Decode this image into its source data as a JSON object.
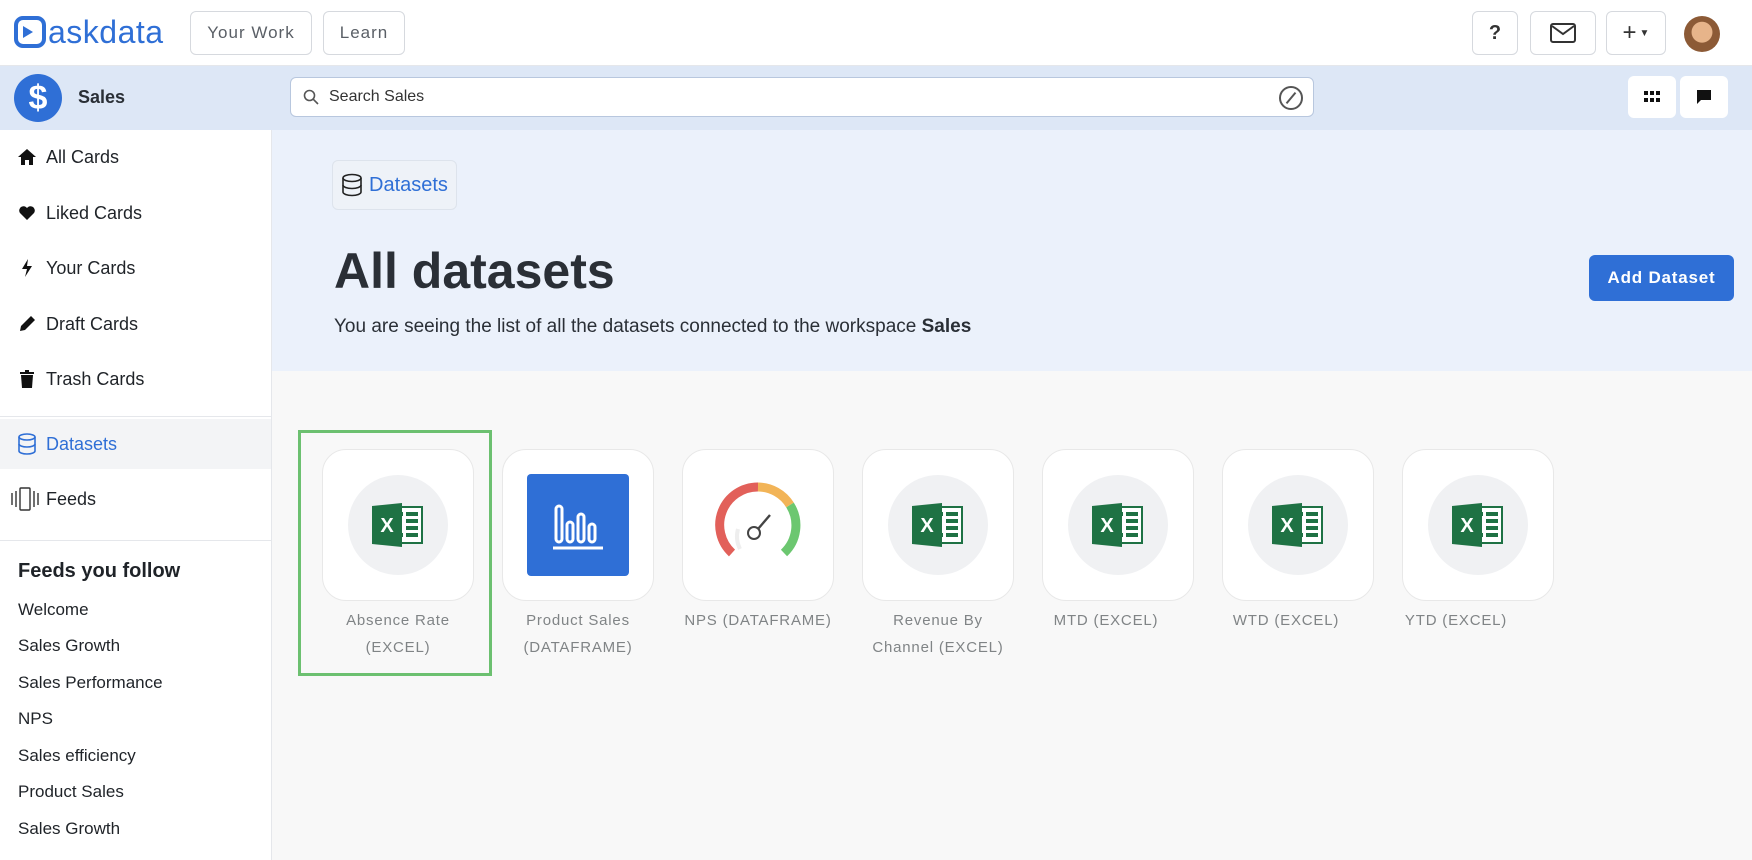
{
  "topbar": {
    "logo_text": "askdata",
    "nav": [
      "Your Work",
      "Learn"
    ],
    "help_label": "?",
    "add_label": "+"
  },
  "workspace": {
    "icon_symbol": "$",
    "name": "Sales",
    "search_placeholder": "Search Sales"
  },
  "sidebar": {
    "items": [
      {
        "label": "All Cards",
        "icon": "home-icon"
      },
      {
        "label": "Liked Cards",
        "icon": "heart-icon"
      },
      {
        "label": "Your Cards",
        "icon": "bolt-icon"
      },
      {
        "label": "Draft Cards",
        "icon": "pencil-icon"
      },
      {
        "label": "Trash Cards",
        "icon": "trash-icon"
      },
      {
        "label": "Datasets",
        "icon": "database-icon",
        "active": true
      },
      {
        "label": "Feeds",
        "icon": "feeds-icon"
      }
    ],
    "follow_title": "Feeds you follow",
    "follow": [
      "Welcome",
      "Sales Growth",
      "Sales Performance",
      "NPS",
      "Sales efficiency",
      "Product Sales",
      "Sales Growth"
    ]
  },
  "main": {
    "breadcrumb": "Datasets",
    "title": "All datasets",
    "subtitle_prefix": "You are seeing the list of all the datasets connected to the workspace",
    "subtitle_workspace": "Sales",
    "add_button": "Add Dataset",
    "datasets": [
      {
        "name_line1": "Absence Rate",
        "name_line2": "(EXCEL)",
        "icon": "excel-icon",
        "selected": true
      },
      {
        "name_line1": "Product Sales",
        "name_line2": "(DATAFRAME)",
        "icon": "bar-chart-icon"
      },
      {
        "name_line1": "NPS (DATAFRAME)",
        "name_line2": "",
        "icon": "gauge-icon"
      },
      {
        "name_line1": "Revenue By",
        "name_line2": "Channel (EXCEL)",
        "icon": "excel-icon"
      },
      {
        "name_line1": "MTD (EXCEL)",
        "name_line2": "",
        "icon": "excel-icon"
      },
      {
        "name_line1": "WTD (EXCEL)",
        "name_line2": "",
        "icon": "excel-icon"
      },
      {
        "name_line1": "YTD (EXCEL)",
        "name_line2": "",
        "icon": "excel-icon"
      }
    ]
  },
  "colors": {
    "accent": "#2f6fd6",
    "excel_green": "#1f7244",
    "selection": "#6cc070"
  }
}
